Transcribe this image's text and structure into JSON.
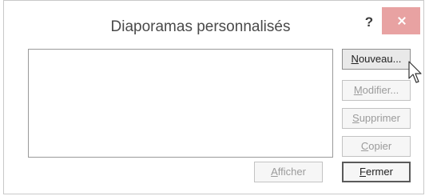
{
  "dialog": {
    "title": "Diaporamas personnalisés",
    "help_label": "?"
  },
  "buttons": {
    "new": {
      "mnemonic": "N",
      "rest": "ouveau..."
    },
    "edit": {
      "mnemonic": "M",
      "rest": "odifier..."
    },
    "delete": {
      "mnemonic": "S",
      "rest": "upprimer"
    },
    "copy": {
      "mnemonic": "C",
      "rest": "opier"
    },
    "show": {
      "mnemonic": "A",
      "rest": "fficher"
    },
    "close": {
      "mnemonic": "F",
      "rest": "ermer"
    }
  },
  "colors": {
    "close_button": "#e8a2a2",
    "disabled_text": "#9b9b9b"
  },
  "icons": [
    "close-icon",
    "mouse-pointer-icon"
  ]
}
